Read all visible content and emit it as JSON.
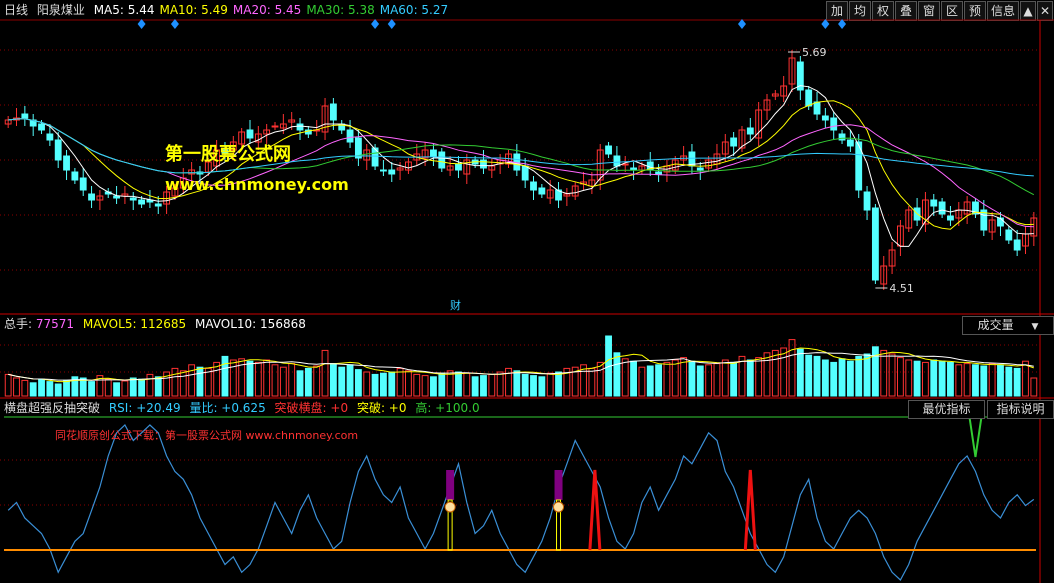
{
  "header": {
    "period": "日线",
    "stock": "阳泉煤业",
    "ma": [
      {
        "label": "MA5:",
        "value": "5.44",
        "color": "#ffffff"
      },
      {
        "label": "MA10:",
        "value": "5.49",
        "color": "#ffff00"
      },
      {
        "label": "MA20:",
        "value": "5.45",
        "color": "#ff66ff"
      },
      {
        "label": "MA30:",
        "value": "5.38",
        "color": "#33cc33"
      },
      {
        "label": "MA60:",
        "value": "5.27",
        "color": "#33ccff"
      }
    ]
  },
  "toolbar": [
    "加",
    "均",
    "权",
    "叠",
    "窗",
    "区",
    "预",
    "信息",
    "▲",
    "✕"
  ],
  "price_pane": {
    "high_label": "5.69",
    "low_label": "4.51",
    "cai_label": "财",
    "watermark_title": "第一股票公式网",
    "watermark_url": "www.chnmoney.com"
  },
  "volume_pane": {
    "total_label": "总手:",
    "total_value": "77571",
    "mavol5_label": "MAVOL5:",
    "mavol5_value": "112685",
    "mavol10_label": "MAVOL10:",
    "mavol10_value": "156868",
    "selector": "成交量"
  },
  "indicator_pane": {
    "name": "横盘超强反抽突破",
    "rsi": "RSI: +20.49",
    "liangbi": "量比: +0.625",
    "tupo_hengpan": "突破横盘: +0",
    "tupo": "突破: +0",
    "gao": "高: +100.0",
    "btn_best": "最优指标",
    "btn_explain": "指标说明",
    "watermark": "同花顺原创公式下载：第一股票公式网 www.chnmoney.com"
  },
  "colors": {
    "up": "#ff3232",
    "down": "#54ffff",
    "ma5": "#ffffff",
    "ma10": "#ffff00",
    "ma20": "#ff66ff",
    "ma30": "#33cc33",
    "ma60": "#33ccff",
    "grid": "#8b0000",
    "signal_marker": "#1e90ff"
  },
  "chart_data": [
    {
      "type": "candlestick",
      "title": "阳泉煤业 日线",
      "ylim": [
        4.45,
        5.75
      ],
      "annotations": [
        {
          "text": "5.69",
          "type": "high"
        },
        {
          "text": "4.51",
          "type": "low"
        }
      ],
      "closes": [
        5.35,
        5.36,
        5.36,
        5.32,
        5.3,
        5.25,
        5.15,
        5.1,
        5.05,
        5.0,
        4.95,
        4.97,
        4.98,
        4.96,
        4.98,
        4.95,
        4.93,
        4.94,
        4.92,
        4.99,
        5.01,
        5.06,
        5.1,
        5.08,
        5.14,
        5.2,
        5.18,
        5.24,
        5.29,
        5.26,
        5.28,
        5.3,
        5.32,
        5.33,
        5.35,
        5.3,
        5.28,
        5.3,
        5.42,
        5.35,
        5.3,
        5.24,
        5.16,
        5.2,
        5.12,
        5.1,
        5.08,
        5.11,
        5.14,
        5.18,
        5.2,
        5.17,
        5.11,
        5.12,
        5.1,
        5.15,
        5.13,
        5.11,
        5.12,
        5.15,
        5.18,
        5.1,
        5.05,
        5.0,
        4.98,
        5.0,
        4.95,
        4.98,
        5.02,
        5.04,
        5.05,
        5.2,
        5.18,
        5.12,
        5.13,
        5.1,
        5.12,
        5.1,
        5.08,
        5.12,
        5.15,
        5.17,
        5.12,
        5.1,
        5.15,
        5.18,
        5.24,
        5.22,
        5.3,
        5.28,
        5.4,
        5.45,
        5.48,
        5.52,
        5.66,
        5.5,
        5.42,
        5.38,
        5.35,
        5.3,
        5.25,
        5.22,
        5.0,
        4.9,
        4.55,
        4.62,
        4.7,
        4.82,
        4.9,
        4.85,
        4.95,
        4.92,
        4.88,
        4.85,
        4.9,
        4.94,
        4.88,
        4.8,
        4.85,
        4.82,
        4.75,
        4.7,
        4.78,
        4.86
      ]
    },
    {
      "type": "bar",
      "title": "成交量",
      "series": [
        {
          "name": "总手",
          "values": [
            180,
            150,
            130,
            110,
            140,
            120,
            100,
            130,
            160,
            150,
            120,
            170,
            140,
            110,
            125,
            150,
            140,
            180,
            160,
            200,
            230,
            210,
            260,
            240,
            230,
            280,
            330,
            300,
            310,
            290,
            280,
            300,
            260,
            240,
            270,
            210,
            230,
            250,
            380,
            270,
            240,
            260,
            220,
            200,
            180,
            190,
            200,
            230,
            210,
            180,
            170,
            160,
            190,
            210,
            200,
            190,
            160,
            170,
            180,
            200,
            230,
            210,
            180,
            170,
            160,
            190,
            200,
            230,
            240,
            260,
            230,
            280,
            500,
            360,
            310,
            290,
            240,
            250,
            260,
            280,
            300,
            320,
            290,
            250,
            260,
            270,
            300,
            280,
            330,
            300,
            320,
            360,
            380,
            400,
            470,
            390,
            340,
            330,
            300,
            280,
            310,
            290,
            330,
            350,
            410,
            380,
            350,
            320,
            300,
            290,
            280,
            300,
            290,
            280,
            260,
            270,
            260,
            250,
            270,
            260,
            240,
            230,
            290,
            150
          ]
        }
      ]
    },
    {
      "type": "line",
      "title": "横盘超强反抽突破",
      "ylim": [
        0,
        100
      ],
      "series": [
        {
          "name": "RSI",
          "values": [
            45,
            50,
            40,
            35,
            30,
            20,
            5,
            15,
            25,
            30,
            45,
            60,
            80,
            95,
            100,
            90,
            95,
            100,
            95,
            80,
            70,
            65,
            55,
            40,
            30,
            20,
            10,
            15,
            5,
            10,
            20,
            35,
            50,
            40,
            30,
            45,
            55,
            40,
            30,
            20,
            25,
            50,
            70,
            80,
            65,
            55,
            50,
            60,
            40,
            30,
            20,
            30,
            45,
            60,
            75,
            50,
            30,
            35,
            45,
            30,
            20,
            10,
            5,
            15,
            25,
            40,
            60,
            75,
            90,
            80,
            70,
            60,
            40,
            25,
            20,
            30,
            50,
            60,
            45,
            55,
            65,
            80,
            75,
            85,
            95,
            90,
            70,
            60,
            45,
            30,
            20,
            10,
            5,
            15,
            35,
            55,
            65,
            40,
            25,
            20,
            30,
            40,
            45,
            40,
            30,
            15,
            5,
            0,
            10,
            25,
            35,
            45,
            55,
            65,
            75,
            80,
            70,
            55,
            45,
            40,
            50,
            55,
            48,
            52
          ]
        }
      ]
    }
  ]
}
